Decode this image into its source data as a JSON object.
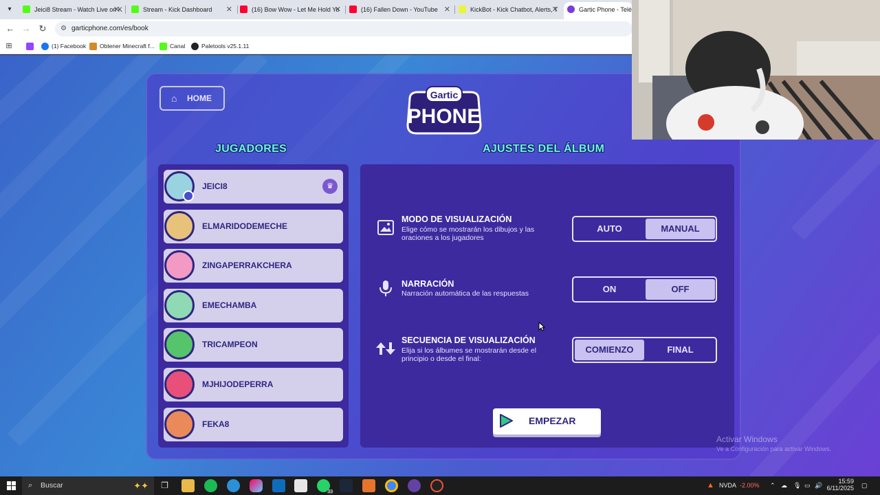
{
  "browser": {
    "tabs": [
      {
        "label": "Jeici8 Stream - Watch Live on K",
        "color": "#53fc18",
        "active": false
      },
      {
        "label": "Stream - Kick Dashboard",
        "color": "#53fc18",
        "active": false
      },
      {
        "label": "(16) Bow Wow - Let Me Hold Yo",
        "color": "#ff0033",
        "active": false
      },
      {
        "label": "(16) Fallen Down - YouTube",
        "color": "#ff0033",
        "active": false
      },
      {
        "label": "KickBot - Kick Chatbot, Alerts, T",
        "color": "#e9f53a",
        "active": false
      },
      {
        "label": "Gartic Phone - Teléfo",
        "color": "#7a3cd6",
        "active": true
      }
    ],
    "url": "garticphone.com/es/book",
    "bookmarks": [
      {
        "label": "",
        "color": "#9146ff"
      },
      {
        "label": "(1) Facebook",
        "color": "#1877f2"
      },
      {
        "label": "Obtener Minecraft f...",
        "color": "#d38a2a"
      },
      {
        "label": "Canal",
        "color": "#53fc18"
      },
      {
        "label": "Paletools v25.1.11",
        "color": "#222222"
      }
    ]
  },
  "game": {
    "home_label": "HOME",
    "logo_line1": "Gartic",
    "logo_line2": "PHONE",
    "players_title": "JUGADORES",
    "settings_title": "AJUSTES DEL ÁLBUM",
    "players": [
      {
        "name": "JEICI8",
        "host": true,
        "avatar_color": "#9ad3e0"
      },
      {
        "name": "ELMARIDODEMECHE",
        "host": false,
        "avatar_color": "#e8c27a"
      },
      {
        "name": "ZINGAPERRAKCHERA",
        "host": false,
        "avatar_color": "#f29ac4"
      },
      {
        "name": "EMECHAMBA",
        "host": false,
        "avatar_color": "#8fd9b5"
      },
      {
        "name": "TRICAMPEON",
        "host": false,
        "avatar_color": "#55c46a"
      },
      {
        "name": "MJHIJODEPERRA",
        "host": false,
        "avatar_color": "#e8507a"
      },
      {
        "name": "FEKA8",
        "host": false,
        "avatar_color": "#ea8a5a"
      }
    ],
    "settings": [
      {
        "title": "MODO DE VISUALIZACIÓN",
        "desc": "Elige cómo se mostrarán los dibujos y las oraciones a los jugadores",
        "icon": "image-icon",
        "options": [
          "AUTO",
          "MANUAL"
        ],
        "selected": 1
      },
      {
        "title": "NARRACIÓN",
        "desc": "Narración automática de las respuestas",
        "icon": "microphone-icon",
        "options": [
          "ON",
          "OFF"
        ],
        "selected": 1
      },
      {
        "title": "SECUENCIA DE VISUALIZACIÓN",
        "desc": "Elija si los álbumes se mostrarán desde el principio o desde el final:",
        "icon": "sort-arrows-icon",
        "options": [
          "COMIENZO",
          "FINAL"
        ],
        "selected": 0
      }
    ],
    "start_label": "EMPEZAR"
  },
  "windows": {
    "watermark_title": "Activar Windows",
    "watermark_sub": "Ve a Configuración para activar Windows.",
    "search_placeholder": "Buscar",
    "stock_name": "NVDA",
    "stock_change": "-2.00%",
    "time": "15:59",
    "date": "6/11/2025",
    "whatsapp_badge": "33"
  }
}
